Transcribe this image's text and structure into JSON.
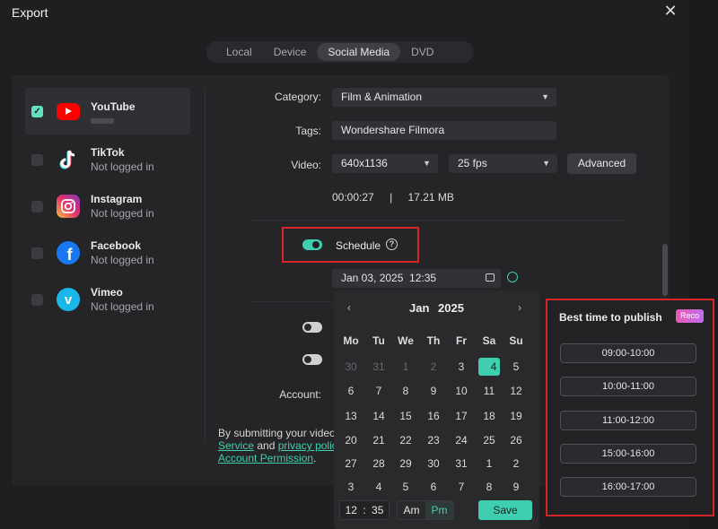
{
  "window": {
    "title": "Export"
  },
  "tabs": [
    {
      "label": "Local",
      "active": false
    },
    {
      "label": "Device",
      "active": false
    },
    {
      "label": "Social Media",
      "active": true
    },
    {
      "label": "DVD",
      "active": false
    }
  ],
  "platforms": [
    {
      "name": "YouTube",
      "status": "",
      "checked": true,
      "icon": "youtube-icon"
    },
    {
      "name": "TikTok",
      "status": "Not logged in",
      "checked": false,
      "icon": "tiktok-icon"
    },
    {
      "name": "Instagram",
      "status": "Not logged in",
      "checked": false,
      "icon": "instagram-icon"
    },
    {
      "name": "Facebook",
      "status": "Not logged in",
      "checked": false,
      "icon": "facebook-icon"
    },
    {
      "name": "Vimeo",
      "status": "Not logged in",
      "checked": false,
      "icon": "vimeo-icon"
    }
  ],
  "form": {
    "category_label": "Category:",
    "category_value": "Film & Animation",
    "tags_label": "Tags:",
    "tags_value": "Wondershare Filmora",
    "video_label": "Video:",
    "resolution": "640x1136",
    "fps": "25 fps",
    "advanced_button": "Advanced",
    "duration": "00:00:27",
    "separator": "|",
    "size": "17.21 MB",
    "schedule_label": "Schedule",
    "schedule_on": true,
    "schedule_datetime": "Jan 03, 2025  12:35",
    "account_label": "Account:"
  },
  "footer": {
    "line1": "By submitting your videos",
    "link1": "Service",
    "and": " and ",
    "link2": "privacy polici",
    "link3": "Account Permission",
    "period": "."
  },
  "calendar": {
    "month": "Jan",
    "year": "2025",
    "prev": "‹",
    "next": "›",
    "weekdays": [
      "Mo",
      "Tu",
      "We",
      "Th",
      "Fr",
      "Sa",
      "Su"
    ],
    "days": [
      [
        "30",
        "31",
        "1",
        "2",
        "3",
        "4",
        "5"
      ],
      [
        "6",
        "7",
        "8",
        "9",
        "10",
        "11",
        "12"
      ],
      [
        "13",
        "14",
        "15",
        "16",
        "17",
        "18",
        "19"
      ],
      [
        "20",
        "21",
        "22",
        "23",
        "24",
        "25",
        "26"
      ],
      [
        "27",
        "28",
        "29",
        "30",
        "31",
        "1",
        "2"
      ],
      [
        "3",
        "4",
        "5",
        "6",
        "7",
        "8",
        "9"
      ]
    ],
    "dim": [
      [
        true,
        true,
        true,
        true,
        false,
        false,
        false
      ],
      [
        false,
        false,
        false,
        false,
        false,
        false,
        false
      ],
      [
        false,
        false,
        false,
        false,
        false,
        false,
        false
      ],
      [
        false,
        false,
        false,
        false,
        false,
        false,
        false
      ],
      [
        false,
        false,
        false,
        false,
        false,
        false,
        false
      ],
      [
        false,
        false,
        false,
        false,
        false,
        false,
        false
      ]
    ],
    "selected": "4",
    "time_hour": "12",
    "time_sep": ":",
    "time_min": "35",
    "am_label": "Am",
    "pm_label": "Pm",
    "pm_active": true,
    "save_label": "Save"
  },
  "best_time": {
    "title": "Best time to publish",
    "badge": "Reco",
    "slots": [
      "09:00-10:00",
      "10:00-11:00",
      "11:00-12:00",
      "15:00-16:00",
      "16:00-17:00"
    ]
  },
  "colors": {
    "accent": "#3ecfb0",
    "highlight": "#d6262a",
    "badge": "#e85ab5"
  }
}
